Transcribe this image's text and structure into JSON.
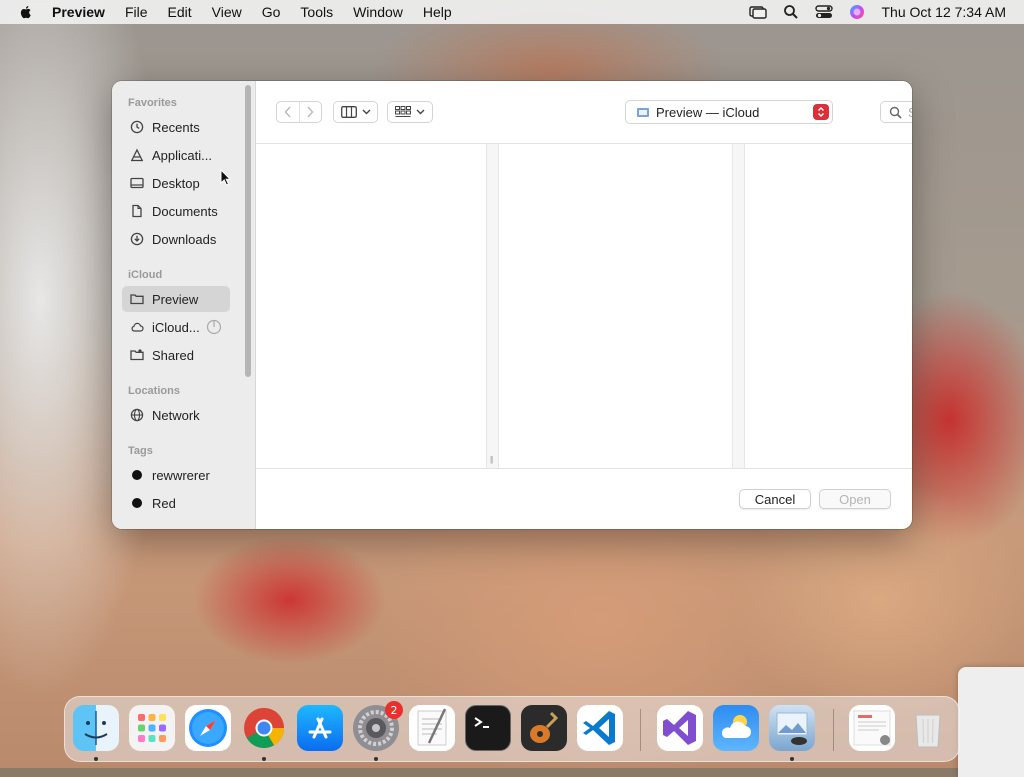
{
  "menubar": {
    "app_name": "Preview",
    "menus": [
      "File",
      "Edit",
      "View",
      "Go",
      "Tools",
      "Window",
      "Help"
    ],
    "clock": "Thu Oct 12  7:34 AM"
  },
  "dialog": {
    "sidebar": {
      "sections": [
        {
          "title": "Favorites",
          "items": [
            {
              "label": "Recents",
              "icon": "clock-icon"
            },
            {
              "label": "Applicati...",
              "icon": "applications-icon"
            },
            {
              "label": "Desktop",
              "icon": "desktop-icon"
            },
            {
              "label": "Documents",
              "icon": "document-icon"
            },
            {
              "label": "Downloads",
              "icon": "download-icon"
            }
          ]
        },
        {
          "title": "iCloud",
          "items": [
            {
              "label": "Preview",
              "icon": "folder-icon",
              "selected": true
            },
            {
              "label": "iCloud...",
              "icon": "cloud-icon"
            },
            {
              "label": "Shared",
              "icon": "shared-folder-icon"
            }
          ]
        },
        {
          "title": "Locations",
          "items": [
            {
              "label": "Network",
              "icon": "globe-icon"
            }
          ]
        },
        {
          "title": "Tags",
          "items": [
            {
              "label": "rewwrerer",
              "icon": "tag-dot-icon",
              "color": "#111111"
            },
            {
              "label": "Red",
              "icon": "tag-dot-icon",
              "color": "#111111"
            }
          ]
        }
      ]
    },
    "toolbar": {
      "path": "Preview — iCloud",
      "search_placeholder": "Search"
    },
    "buttons": {
      "cancel": "Cancel",
      "open": "Open"
    }
  },
  "dock": {
    "apps": [
      {
        "name": "Finder",
        "icon": "finder-icon",
        "running": true
      },
      {
        "name": "Launchpad",
        "icon": "launchpad-icon"
      },
      {
        "name": "Safari",
        "icon": "safari-icon"
      },
      {
        "name": "Google Chrome",
        "icon": "chrome-icon",
        "running": true
      },
      {
        "name": "App Store",
        "icon": "app-store-icon"
      },
      {
        "name": "System Settings",
        "icon": "settings-icon",
        "badge": "2",
        "running": true
      },
      {
        "name": "TextEdit",
        "icon": "textedit-icon"
      },
      {
        "name": "Terminal",
        "icon": "terminal-icon"
      },
      {
        "name": "GarageBand",
        "icon": "garageband-icon"
      },
      {
        "name": "Visual Studio Code",
        "icon": "vscode-icon"
      },
      {
        "name": "Visual Studio",
        "icon": "visual-studio-icon"
      },
      {
        "name": "Weather",
        "icon": "weather-icon"
      },
      {
        "name": "Preview",
        "icon": "preview-icon",
        "running": true
      },
      {
        "name": "Recent Document",
        "icon": "document-stack-icon"
      },
      {
        "name": "Trash",
        "icon": "trash-icon"
      }
    ]
  },
  "colors": {
    "accent_red": "#d9303a",
    "sidebar_bg": "#ececec",
    "selected_bg": "#d5d5d5"
  }
}
